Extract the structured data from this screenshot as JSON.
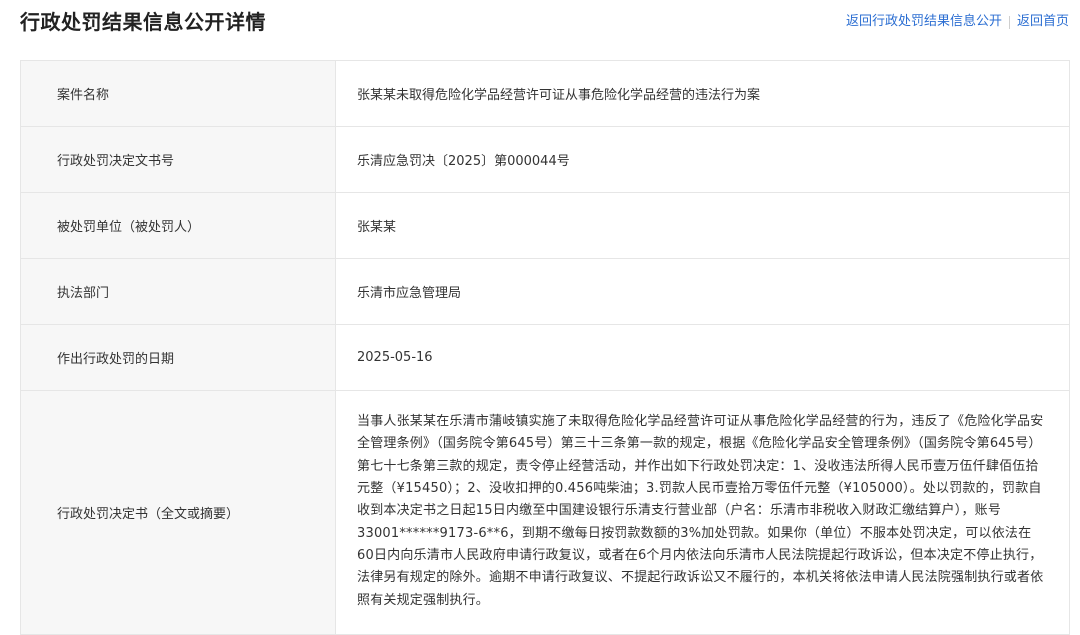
{
  "header": {
    "title": "行政处罚结果信息公开详情",
    "links": [
      {
        "label": "返回行政处罚结果信息公开"
      },
      {
        "label": "返回首页"
      }
    ]
  },
  "rows": [
    {
      "label": "案件名称",
      "value": "张某某未取得危险化学品经营许可证从事危险化学品经营的违法行为案"
    },
    {
      "label": "行政处罚决定文书号",
      "value": "乐清应急罚决〔2025〕第000044号"
    },
    {
      "label": "被处罚单位（被处罚人）",
      "value": "张某某"
    },
    {
      "label": "执法部门",
      "value": "乐清市应急管理局"
    },
    {
      "label": "作出行政处罚的日期",
      "value": "2025-05-16"
    },
    {
      "label": "行政处罚决定书（全文或摘要）",
      "value": "当事人张某某在乐清市蒲岐镇实施了未取得危险化学品经营许可证从事危险化学品经营的行为，违反了《危险化学品安全管理条例》（国务院令第645号）第三十三条第一款的规定，根据《危险化学品安全管理条例》（国务院令第645号）第七十七条第三款的规定，责令停止经营活动，并作出如下行政处罚决定：1、没收违法所得人民币壹万伍仟肆佰伍拾元整（¥15450）；2、没收扣押的0.456吨柴油；3.罚款人民币壹拾万零伍仟元整（¥105000）。处以罚款的，罚款自收到本决定书之日起15日内缴至中国建设银行乐清支行营业部（户名：乐清市非税收入财政汇缴结算户），账号33001******9173-6**6，到期不缴每日按罚款数额的3%加处罚款。如果你（单位）不服本处罚决定，可以依法在60日内向乐清市人民政府申请行政复议，或者在6个月内依法向乐清市人民法院提起行政诉讼，但本决定不停止执行，法律另有规定的除外。逾期不申请行政复议、不提起行政诉讼又不履行的，本机关将依法申请人民法院强制执行或者依照有关规定强制执行。"
    }
  ],
  "colors": {
    "link": "#2b6ed2",
    "label_bg": "#f7f7f7",
    "border": "#e6e6e6"
  }
}
